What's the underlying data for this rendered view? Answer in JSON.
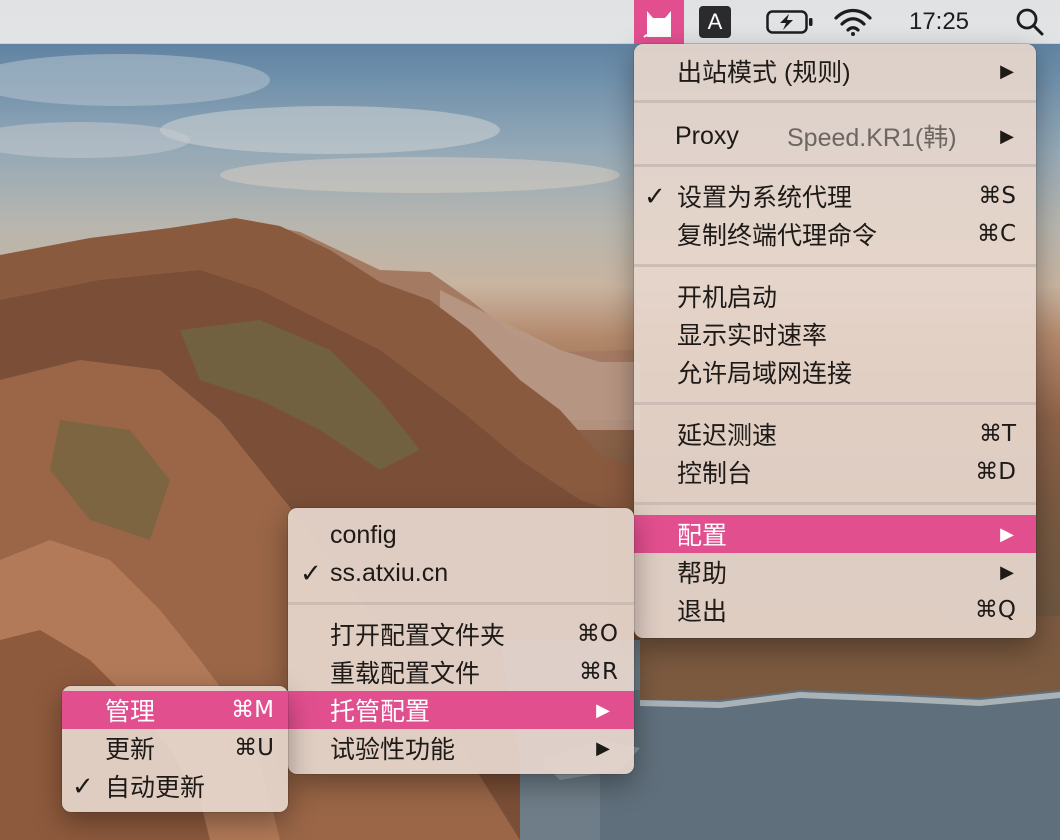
{
  "menubar": {
    "clash_icon": "cat-icon",
    "input_method": "A",
    "battery_icon": "battery-charging-icon",
    "wifi_icon": "wifi-icon",
    "time": "17:25",
    "search_icon": "spotlight-search-icon"
  },
  "main_menu": {
    "outbound_mode": "出站模式 (规则)",
    "proxy_label": "Proxy",
    "proxy_value": "Speed.KR1(韩)",
    "set_system_proxy": "设置为系统代理",
    "set_system_proxy_shortcut": "⌘S",
    "copy_terminal_command": "复制终端代理命令",
    "copy_terminal_command_shortcut": "⌘C",
    "launch_at_login": "开机启动",
    "show_speed": "显示实时速率",
    "allow_lan": "允许局域网连接",
    "latency_test": "延迟测速",
    "latency_test_shortcut": "⌘T",
    "dashboard": "控制台",
    "dashboard_shortcut": "⌘D",
    "config": "配置",
    "help": "帮助",
    "quit": "退出",
    "quit_shortcut": "⌘Q",
    "check_mark": "✓",
    "arrow": "▶"
  },
  "config_menu": {
    "config_item": "config",
    "ss_item": "ss.atxiu.cn",
    "open_folder": "打开配置文件夹",
    "open_folder_shortcut": "⌘O",
    "reload": "重载配置文件",
    "reload_shortcut": "⌘R",
    "managed": "托管配置",
    "experimental": "试验性功能",
    "check_mark": "✓",
    "arrow": "▶"
  },
  "managed_menu": {
    "manage": "管理",
    "manage_shortcut": "⌘M",
    "update": "更新",
    "update_shortcut": "⌘U",
    "auto_update": "自动更新",
    "check_mark": "✓"
  },
  "colors": {
    "highlight": "#e24f8f",
    "menu_background": "#e6d6cc",
    "menubar_background": "#ecebea"
  }
}
